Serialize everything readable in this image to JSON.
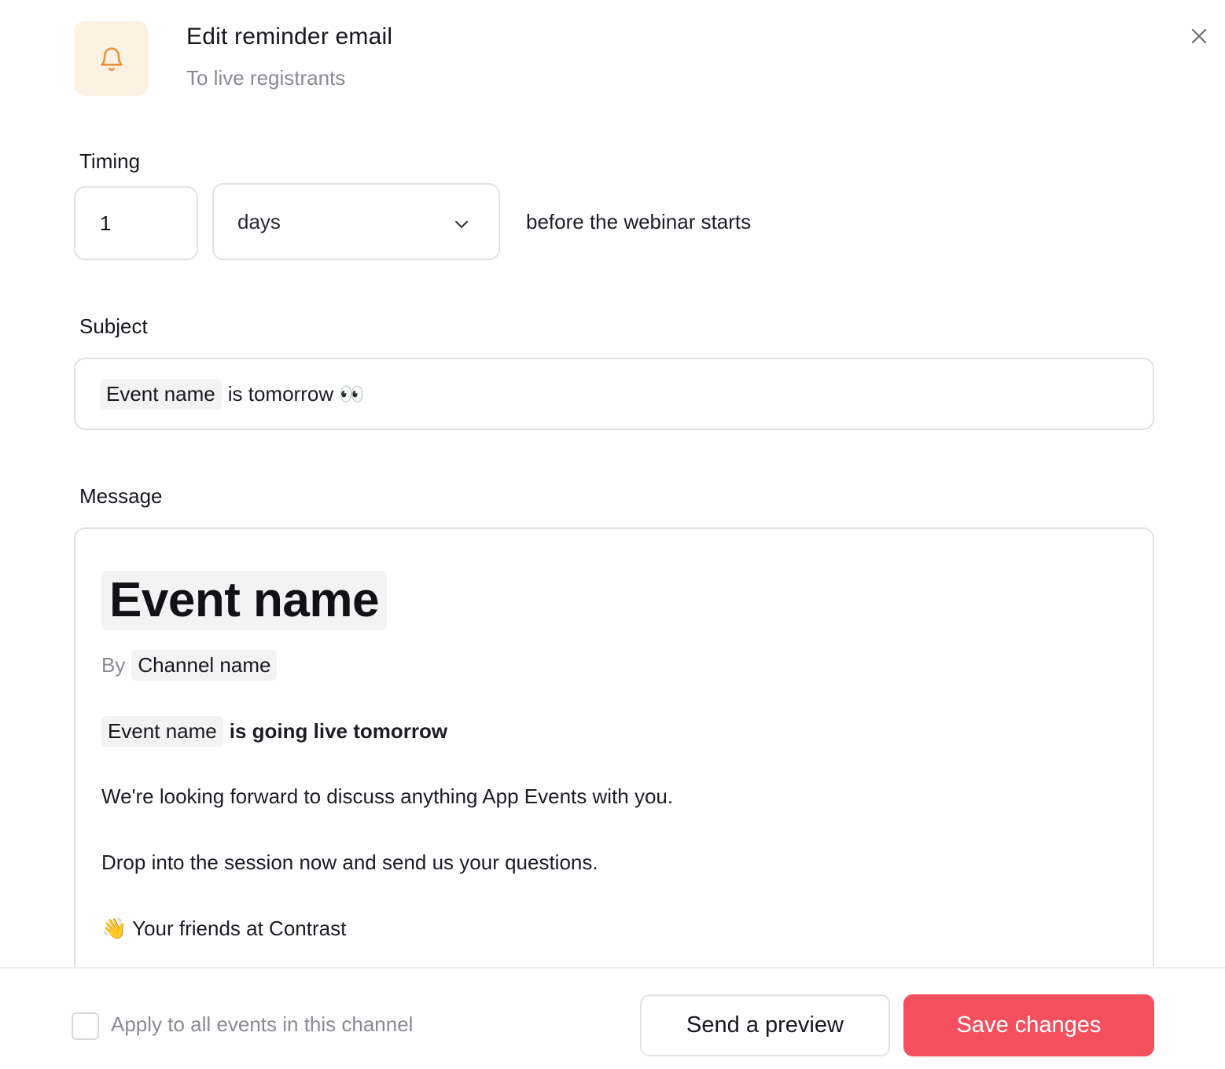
{
  "header": {
    "title": "Edit reminder email",
    "subtitle": "To live registrants",
    "icon": "bell-icon",
    "icon_color": "#e8923a",
    "icon_bg": "#fdf1e4"
  },
  "timing": {
    "label": "Timing",
    "quantity": "1",
    "unit": "days",
    "suffix": "before the webinar starts"
  },
  "subject": {
    "label": "Subject",
    "chip": "Event name",
    "text": "is tomorrow 👀"
  },
  "message": {
    "label": "Message",
    "title_chip": "Event name",
    "by_label": "By",
    "channel_chip": "Channel name",
    "live_chip": "Event name",
    "live_text": "is going live tomorrow",
    "line1": "We're looking forward to discuss anything App Events with you.",
    "line2": "Drop into the session now and send us your questions.",
    "line3": "👋 Your friends at Contrast"
  },
  "footer": {
    "apply_label": "Apply to all events in this channel",
    "preview_label": "Send a preview",
    "save_label": "Save changes",
    "save_color": "#f5505e"
  }
}
